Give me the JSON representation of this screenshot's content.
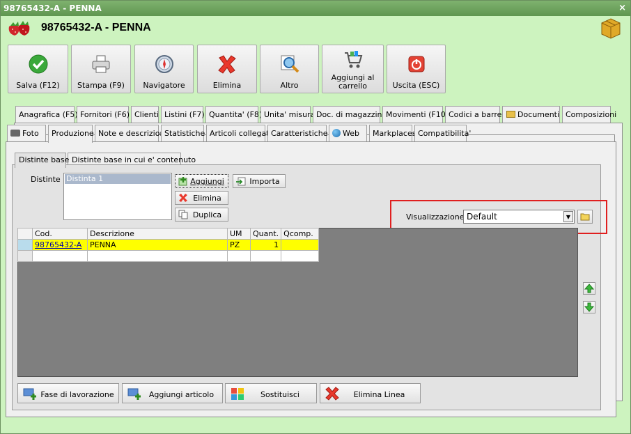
{
  "window": {
    "title": "98765432-A - PENNA",
    "close_glyph": "×",
    "header_title": "98765432-A - PENNA",
    "colors": {
      "background": "#cdf3bf",
      "titlebar": "#6aa35b",
      "highlight": "#e01f1f",
      "selected_row": "#ffff00"
    }
  },
  "toolbar": [
    {
      "label": "Salva (F12)",
      "icon": "check-icon"
    },
    {
      "label": "Stampa (F9)",
      "icon": "printer-icon"
    },
    {
      "label": "Navigatore",
      "icon": "compass-icon"
    },
    {
      "label": "Elimina",
      "icon": "delete-x-icon"
    },
    {
      "label": "Altro",
      "icon": "magnifier-icon"
    },
    {
      "label": "Aggiungi al carrello",
      "icon": "cart-icon"
    },
    {
      "label": "Uscita (ESC)",
      "icon": "power-icon"
    }
  ],
  "tabs_row1": [
    "Anagrafica (F5)",
    "Fornitori (F6)",
    "Clienti",
    "Listini (F7)",
    "Quantita' (F8)",
    "Unita' misura",
    "Doc. di magazzino",
    "Movimenti (F10)",
    "Codici a barre",
    "Documenti",
    "Composizioni"
  ],
  "tabs_row2": [
    "Foto",
    "Produzione",
    "Note e descrizioni",
    "Statistiche",
    "Articoli collegati",
    "Caratteristiche",
    "Web",
    "Markplaces",
    "Compatibilita'"
  ],
  "active_tab": "Produzione",
  "subtabs": [
    "Distinte base",
    "Distinte base in cui e' contenuto"
  ],
  "active_subtab": "Distinte base",
  "distinte": {
    "label": "Distinte :",
    "items": [
      "Distinta 1"
    ],
    "selected": "Distinta 1",
    "buttons": {
      "add": "Aggiungi",
      "delete": "Elimina",
      "duplicate": "Duplica",
      "import": "Importa"
    }
  },
  "visualizzazione": {
    "label": "Visualizzazione :",
    "value": "Default",
    "arrow": "▼"
  },
  "grid": {
    "columns": [
      "Cod.",
      "Descrizione",
      "UM",
      "Quant.",
      "Qcomp."
    ],
    "rows": [
      {
        "cod": "98765432-A",
        "descrizione": "PENNA",
        "um": "PZ",
        "quant": "1",
        "qcomp": ""
      },
      {
        "cod": "",
        "descrizione": "",
        "um": "",
        "quant": "",
        "qcomp": ""
      }
    ]
  },
  "bottom_buttons": {
    "phase": "Fase di lavorazione",
    "add_article": "Aggiungi articolo",
    "replace": "Sostituisci",
    "delete_line": "Elimina Linea"
  }
}
